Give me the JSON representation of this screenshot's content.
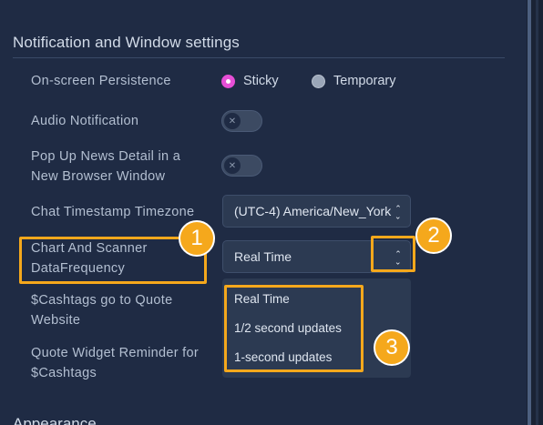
{
  "section": {
    "title": "Notification and Window settings"
  },
  "settings": {
    "persistence": {
      "label": "On-screen Persistence",
      "options": [
        {
          "label": "Sticky",
          "selected": true
        },
        {
          "label": "Temporary",
          "selected": false
        }
      ]
    },
    "audio": {
      "label": "Audio Notification",
      "enabled": false
    },
    "popup": {
      "label_line1": "Pop Up News Detail in a",
      "label_line2": "New Browser Window",
      "enabled": false
    },
    "timezone": {
      "label": "Chat Timestamp Timezone",
      "value": "(UTC-4) America/New_York"
    },
    "frequency": {
      "label_line1": "Chart And Scanner",
      "label_line2": "DataFrequency",
      "value": "Real Time",
      "options": [
        "Real Time",
        "1/2 second updates",
        "1-second updates"
      ]
    },
    "cashtags_quote": {
      "label_line1": "$Cashtags go to Quote",
      "label_line2": "Website"
    },
    "quote_widget": {
      "label_line1": "Quote Widget Reminder for",
      "label_line2": "$Cashtags"
    }
  },
  "badges": [
    "1",
    "2",
    "3"
  ],
  "next_section": {
    "title": "Appearance"
  },
  "colors": {
    "accent_radio": "#e64fd6",
    "highlight": "#f5a81c",
    "background": "#1f2b44"
  }
}
